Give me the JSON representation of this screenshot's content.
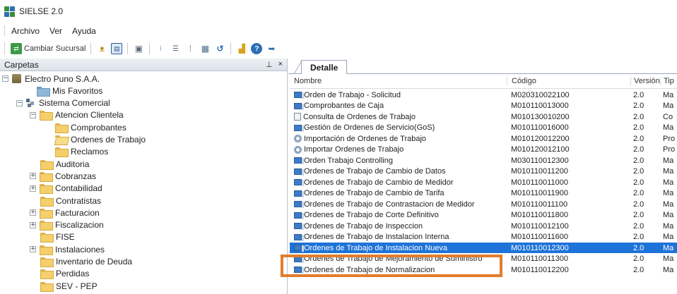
{
  "window": {
    "title": "SIELSE 2.0"
  },
  "menu": [
    "Archivo",
    "Ver",
    "Ayuda"
  ],
  "toolbar": {
    "change_branch_label": "Cambiar Sucursal",
    "icons": [
      "change-branch-icon",
      "binoculars-icon",
      "form-icon",
      "panel-icon",
      "list-small-icon",
      "list-indent-icon",
      "details-icon",
      "grid-icon",
      "refresh-icon",
      "chart-icon",
      "help-icon",
      "exit-icon"
    ]
  },
  "left_panel": {
    "title": "Carpetas",
    "pin_glyph": "⊥",
    "close_glyph": "×",
    "tree": [
      {
        "label": "Electro Puno S.A.A.",
        "expander": "−",
        "icon": "company"
      },
      {
        "label": "Mis Favoritos",
        "expander": "",
        "icon": "folder-blue"
      },
      {
        "label": "Sistema Comercial",
        "expander": "−",
        "icon": "system"
      },
      {
        "label": "Atencion Clientela",
        "expander": "−",
        "icon": "folder"
      },
      {
        "label": "Comprobantes",
        "expander": "",
        "icon": "folder"
      },
      {
        "label": "Ordenes de Trabajo",
        "expander": "",
        "icon": "folder-open"
      },
      {
        "label": "Reclamos",
        "expander": "",
        "icon": "folder"
      },
      {
        "label": "Auditoria",
        "expander": "",
        "icon": "folder"
      },
      {
        "label": "Cobranzas",
        "expander": "+",
        "icon": "folder"
      },
      {
        "label": "Contabilidad",
        "expander": "+",
        "icon": "folder"
      },
      {
        "label": "Contratistas",
        "expander": "",
        "icon": "folder"
      },
      {
        "label": "Facturacion",
        "expander": "+",
        "icon": "folder"
      },
      {
        "label": "Fiscalizacion",
        "expander": "+",
        "icon": "folder"
      },
      {
        "label": "FISE",
        "expander": "",
        "icon": "folder"
      },
      {
        "label": "Instalaciones",
        "expander": "+",
        "icon": "folder"
      },
      {
        "label": "Inventario de Deuda",
        "expander": "",
        "icon": "folder"
      },
      {
        "label": "Perdidas",
        "expander": "",
        "icon": "folder"
      },
      {
        "label": "SEV - PEP",
        "expander": "",
        "icon": "folder"
      }
    ]
  },
  "detail": {
    "tab_label": "Detalle",
    "columns": {
      "name": "Nombre",
      "code": "Código",
      "version": "Versión",
      "type": "Tip"
    },
    "rows": [
      {
        "name": "Orden de Trabajo - Solicitud",
        "code": "M020310022100",
        "version": "2.0",
        "type": "Ma",
        "icon": "form"
      },
      {
        "name": "Comprobantes de Caja",
        "code": "M010110013000",
        "version": "2.0",
        "type": "Ma",
        "icon": "form"
      },
      {
        "name": "Consulta de Ordenes de Trabajo",
        "code": "M010130010200",
        "version": "2.0",
        "type": "Co",
        "icon": "doc"
      },
      {
        "name": "Gestión de Ordenes de Servicio(GoS)",
        "code": "M010110016000",
        "version": "2.0",
        "type": "Ma",
        "icon": "form"
      },
      {
        "name": "Importación de Ordenes de Trabajo",
        "code": "M010120012200",
        "version": "2.0",
        "type": "Pro",
        "icon": "gear"
      },
      {
        "name": "Importar Ordenes de Trabajo",
        "code": "M010120012100",
        "version": "2.0",
        "type": "Pro",
        "icon": "gear"
      },
      {
        "name": "Orden Trabajo Controlling",
        "code": "M030110012300",
        "version": "2.0",
        "type": "Ma",
        "icon": "form"
      },
      {
        "name": "Ordenes de Trabajo de Cambio de Datos",
        "code": "M010110011200",
        "version": "2.0",
        "type": "Ma",
        "icon": "form"
      },
      {
        "name": "Ordenes de Trabajo de Cambio de Medidor",
        "code": "M010110011000",
        "version": "2.0",
        "type": "Ma",
        "icon": "form"
      },
      {
        "name": "Ordenes de Trabajo de Cambio de Tarifa",
        "code": "M010110011900",
        "version": "2.0",
        "type": "Ma",
        "icon": "form"
      },
      {
        "name": "Ordenes de Trabajo de Contrastacion de Medidor",
        "code": "M010110011100",
        "version": "2.0",
        "type": "Ma",
        "icon": "form"
      },
      {
        "name": "Ordenes de Trabajo de Corte Definitivo",
        "code": "M010110011800",
        "version": "2.0",
        "type": "Ma",
        "icon": "form"
      },
      {
        "name": "Ordenes de Trabajo de Inspeccion",
        "code": "M010110012100",
        "version": "2.0",
        "type": "Ma",
        "icon": "form"
      },
      {
        "name": "Ordenes de Trabajo de Instalacion Interna",
        "code": "M010110011600",
        "version": "2.0",
        "type": "Ma",
        "icon": "form"
      },
      {
        "name": "Ordenes de Trabajo de Instalacion Nueva",
        "code": "M010110012300",
        "version": "2.0",
        "type": "Ma",
        "icon": "form",
        "selected": true
      },
      {
        "name": "Ordenes de Trabajo de Mejoramiento de Suministro",
        "code": "M010110011300",
        "version": "2.0",
        "type": "Ma",
        "icon": "form"
      },
      {
        "name": "Ordenes de Trabajo de Normalizacion",
        "code": "M010110012200",
        "version": "2.0",
        "type": "Ma",
        "icon": "form"
      }
    ]
  },
  "colors": {
    "selection": "#1e73d8",
    "highlight_box": "#e27d2b",
    "folder": "#f4cf6b"
  }
}
